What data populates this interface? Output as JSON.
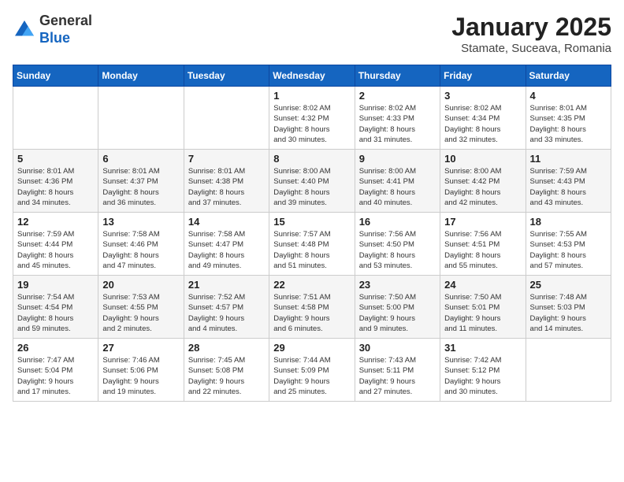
{
  "header": {
    "logo_general": "General",
    "logo_blue": "Blue",
    "month": "January 2025",
    "location": "Stamate, Suceava, Romania"
  },
  "days_of_week": [
    "Sunday",
    "Monday",
    "Tuesday",
    "Wednesday",
    "Thursday",
    "Friday",
    "Saturday"
  ],
  "weeks": [
    [
      {
        "day": "",
        "info": ""
      },
      {
        "day": "",
        "info": ""
      },
      {
        "day": "",
        "info": ""
      },
      {
        "day": "1",
        "info": "Sunrise: 8:02 AM\nSunset: 4:32 PM\nDaylight: 8 hours\nand 30 minutes."
      },
      {
        "day": "2",
        "info": "Sunrise: 8:02 AM\nSunset: 4:33 PM\nDaylight: 8 hours\nand 31 minutes."
      },
      {
        "day": "3",
        "info": "Sunrise: 8:02 AM\nSunset: 4:34 PM\nDaylight: 8 hours\nand 32 minutes."
      },
      {
        "day": "4",
        "info": "Sunrise: 8:01 AM\nSunset: 4:35 PM\nDaylight: 8 hours\nand 33 minutes."
      }
    ],
    [
      {
        "day": "5",
        "info": "Sunrise: 8:01 AM\nSunset: 4:36 PM\nDaylight: 8 hours\nand 34 minutes."
      },
      {
        "day": "6",
        "info": "Sunrise: 8:01 AM\nSunset: 4:37 PM\nDaylight: 8 hours\nand 36 minutes."
      },
      {
        "day": "7",
        "info": "Sunrise: 8:01 AM\nSunset: 4:38 PM\nDaylight: 8 hours\nand 37 minutes."
      },
      {
        "day": "8",
        "info": "Sunrise: 8:00 AM\nSunset: 4:40 PM\nDaylight: 8 hours\nand 39 minutes."
      },
      {
        "day": "9",
        "info": "Sunrise: 8:00 AM\nSunset: 4:41 PM\nDaylight: 8 hours\nand 40 minutes."
      },
      {
        "day": "10",
        "info": "Sunrise: 8:00 AM\nSunset: 4:42 PM\nDaylight: 8 hours\nand 42 minutes."
      },
      {
        "day": "11",
        "info": "Sunrise: 7:59 AM\nSunset: 4:43 PM\nDaylight: 8 hours\nand 43 minutes."
      }
    ],
    [
      {
        "day": "12",
        "info": "Sunrise: 7:59 AM\nSunset: 4:44 PM\nDaylight: 8 hours\nand 45 minutes."
      },
      {
        "day": "13",
        "info": "Sunrise: 7:58 AM\nSunset: 4:46 PM\nDaylight: 8 hours\nand 47 minutes."
      },
      {
        "day": "14",
        "info": "Sunrise: 7:58 AM\nSunset: 4:47 PM\nDaylight: 8 hours\nand 49 minutes."
      },
      {
        "day": "15",
        "info": "Sunrise: 7:57 AM\nSunset: 4:48 PM\nDaylight: 8 hours\nand 51 minutes."
      },
      {
        "day": "16",
        "info": "Sunrise: 7:56 AM\nSunset: 4:50 PM\nDaylight: 8 hours\nand 53 minutes."
      },
      {
        "day": "17",
        "info": "Sunrise: 7:56 AM\nSunset: 4:51 PM\nDaylight: 8 hours\nand 55 minutes."
      },
      {
        "day": "18",
        "info": "Sunrise: 7:55 AM\nSunset: 4:53 PM\nDaylight: 8 hours\nand 57 minutes."
      }
    ],
    [
      {
        "day": "19",
        "info": "Sunrise: 7:54 AM\nSunset: 4:54 PM\nDaylight: 8 hours\nand 59 minutes."
      },
      {
        "day": "20",
        "info": "Sunrise: 7:53 AM\nSunset: 4:55 PM\nDaylight: 9 hours\nand 2 minutes."
      },
      {
        "day": "21",
        "info": "Sunrise: 7:52 AM\nSunset: 4:57 PM\nDaylight: 9 hours\nand 4 minutes."
      },
      {
        "day": "22",
        "info": "Sunrise: 7:51 AM\nSunset: 4:58 PM\nDaylight: 9 hours\nand 6 minutes."
      },
      {
        "day": "23",
        "info": "Sunrise: 7:50 AM\nSunset: 5:00 PM\nDaylight: 9 hours\nand 9 minutes."
      },
      {
        "day": "24",
        "info": "Sunrise: 7:50 AM\nSunset: 5:01 PM\nDaylight: 9 hours\nand 11 minutes."
      },
      {
        "day": "25",
        "info": "Sunrise: 7:48 AM\nSunset: 5:03 PM\nDaylight: 9 hours\nand 14 minutes."
      }
    ],
    [
      {
        "day": "26",
        "info": "Sunrise: 7:47 AM\nSunset: 5:04 PM\nDaylight: 9 hours\nand 17 minutes."
      },
      {
        "day": "27",
        "info": "Sunrise: 7:46 AM\nSunset: 5:06 PM\nDaylight: 9 hours\nand 19 minutes."
      },
      {
        "day": "28",
        "info": "Sunrise: 7:45 AM\nSunset: 5:08 PM\nDaylight: 9 hours\nand 22 minutes."
      },
      {
        "day": "29",
        "info": "Sunrise: 7:44 AM\nSunset: 5:09 PM\nDaylight: 9 hours\nand 25 minutes."
      },
      {
        "day": "30",
        "info": "Sunrise: 7:43 AM\nSunset: 5:11 PM\nDaylight: 9 hours\nand 27 minutes."
      },
      {
        "day": "31",
        "info": "Sunrise: 7:42 AM\nSunset: 5:12 PM\nDaylight: 9 hours\nand 30 minutes."
      },
      {
        "day": "",
        "info": ""
      }
    ]
  ]
}
